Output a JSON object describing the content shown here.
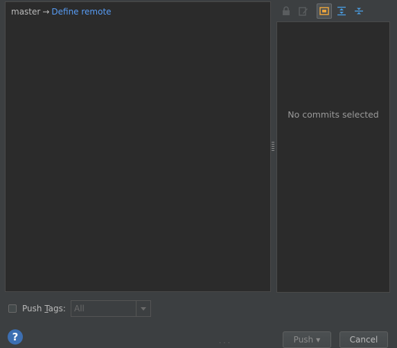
{
  "branch": {
    "local": "master",
    "arrow": "→",
    "remote_link": "Define remote"
  },
  "details": {
    "empty_text": "No commits selected"
  },
  "toolbar": {
    "icons": [
      "lock-icon",
      "edit-icon",
      "show-details-icon",
      "expand-all-icon",
      "collapse-all-icon"
    ],
    "active": "show-details-icon"
  },
  "push_tags": {
    "label_prefix": "Push ",
    "label_mnemonic": "T",
    "label_suffix": "ags:",
    "checked": false,
    "combo_value": "All"
  },
  "buttons": {
    "help": "?",
    "push": "Push",
    "cancel": "Cancel"
  },
  "colors": {
    "background": "#3c3f41",
    "panel": "#2b2b2b",
    "link": "#589df6",
    "accent": "#e8a33d"
  }
}
